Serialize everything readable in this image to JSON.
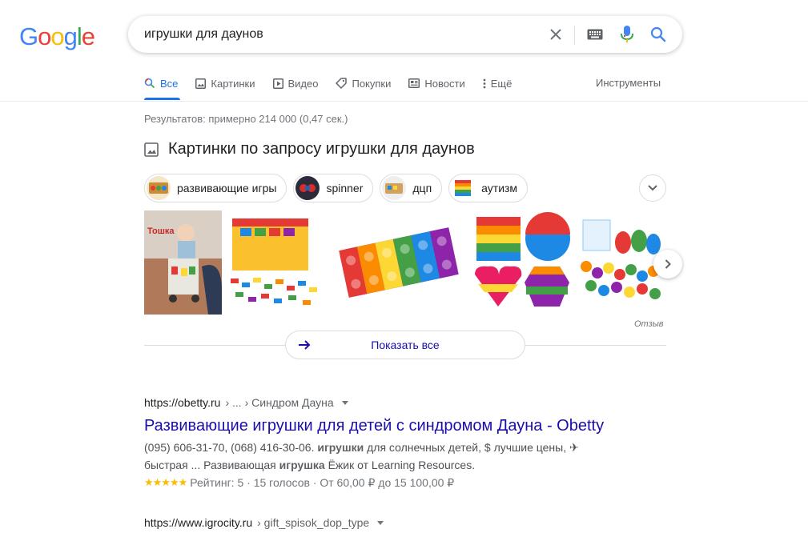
{
  "logo": {
    "g1": "G",
    "o1": "o",
    "o2": "o",
    "g2": "g",
    "l": "l",
    "e": "e"
  },
  "search": {
    "query": "игрушки для даунов"
  },
  "tabs": [
    {
      "label": "Все",
      "icon": "search-icon"
    },
    {
      "label": "Картинки",
      "icon": "image-icon"
    },
    {
      "label": "Видео",
      "icon": "video-icon"
    },
    {
      "label": "Покупки",
      "icon": "tag-icon"
    },
    {
      "label": "Новости",
      "icon": "newspaper-icon"
    },
    {
      "label": "Ещё",
      "icon": "more-vert-icon"
    }
  ],
  "tools_label": "Инструменты",
  "stats": "Результатов: примерно 214 000 (0,47 сек.)",
  "images": {
    "heading": "Картинки по запросу игрушки для даунов",
    "chips": [
      "развивающие игры",
      "spinner",
      "дцп",
      "аутизм"
    ],
    "thumb_caption": "Тошка",
    "feedback": "Отзыв",
    "show_all": "Показать все"
  },
  "results": [
    {
      "site": "https://obetty.ru",
      "path": "› ... › Синдром Дауна",
      "title": "Развивающие игрушки для детей с синдромом Дауна - Obetty",
      "snippet_a": "(095) 606-31-70, (068) 416-30-06.",
      "snippet_b": "игрушки",
      "snippet_c": "для солнечных детей, $ лучшие цены, ✈",
      "snippet_d": "быстрая ... Развивающая",
      "snippet_e": "игрушка",
      "snippet_f": "Ёжик от Learning Resources.",
      "rating_stars": "★★★★★",
      "rating_text": "Рейтинг: 5 · 15 голосов · От 60,00 ₽ до 15 100,00 ₽"
    },
    {
      "site": "https://www.igrocity.ru",
      "path": "› gift_spisok_dop_type"
    }
  ]
}
